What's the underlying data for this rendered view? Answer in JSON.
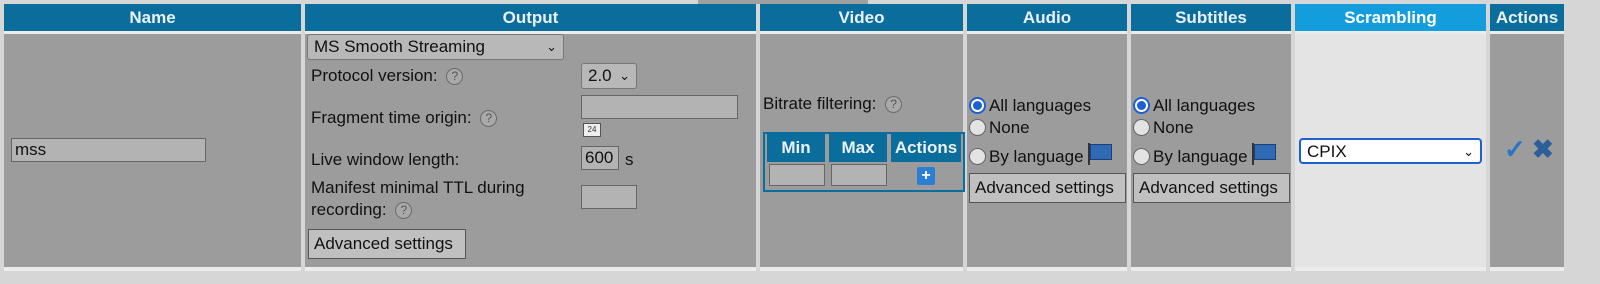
{
  "headers": {
    "name": "Name",
    "output": "Output",
    "video": "Video",
    "audio": "Audio",
    "subtitles": "Subtitles",
    "scrambling": "Scrambling",
    "actions": "Actions"
  },
  "row": {
    "name_value": "mss",
    "output": {
      "format": "MS Smooth Streaming",
      "protocol_label": "Protocol version:",
      "protocol_value": "2.0",
      "fragment_label": "Fragment time origin:",
      "fragment_value": "",
      "calendar_glyph": "24",
      "live_window_label": "Live window length:",
      "live_window_value": "600",
      "live_window_unit": "s",
      "manifest_label_1": "Manifest minimal TTL during",
      "manifest_label_2": "recording:",
      "manifest_value": "",
      "advanced": "Advanced settings"
    },
    "video": {
      "bitrate_label": "Bitrate filtering:",
      "col_min": "Min",
      "col_max": "Max",
      "col_actions": "Actions",
      "add_glyph": "+"
    },
    "audio": {
      "all": "All languages",
      "none": "None",
      "by_language": "By language",
      "advanced": "Advanced settings",
      "selected": "all"
    },
    "subtitles": {
      "all": "All languages",
      "none": "None",
      "by_language": "By language",
      "advanced": "Advanced settings",
      "selected": "all"
    },
    "scrambling": {
      "value": "CPIX"
    },
    "actions": {
      "confirm_glyph": "✓",
      "cancel_glyph": "✖"
    }
  },
  "colors": {
    "header": "#0b6d9b",
    "header_active": "#149ddd",
    "cell": "#9c9c9c",
    "cell_active": "#e4e4e4",
    "radio_selected": "#1e5fd1"
  }
}
